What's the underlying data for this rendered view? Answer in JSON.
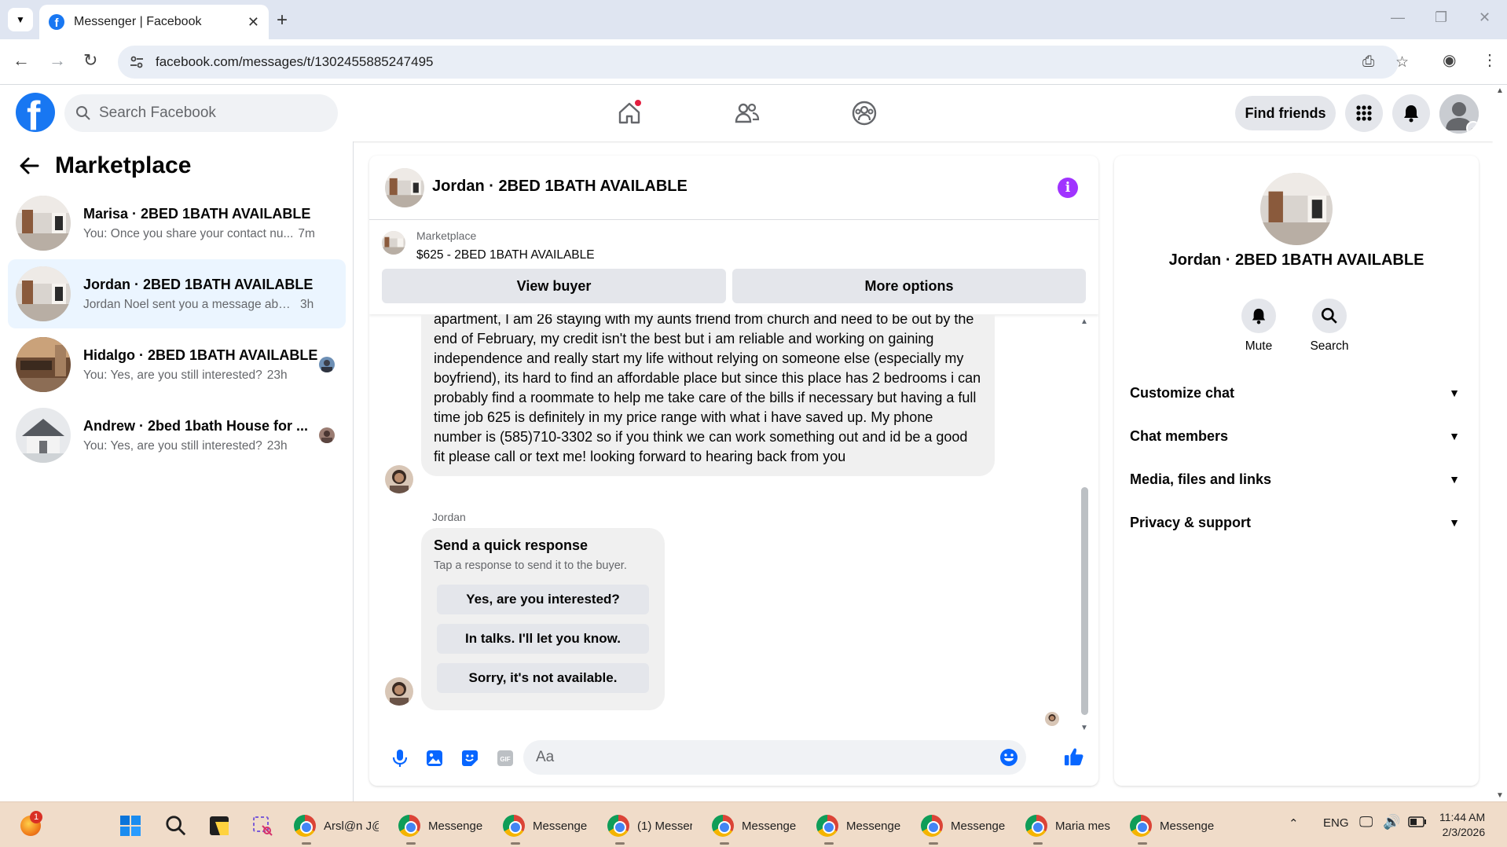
{
  "browser": {
    "tab_title": "Messenger | Facebook",
    "url": "facebook.com/messages/t/1302455885247495"
  },
  "fb": {
    "search_placeholder": "Search Facebook",
    "find_friends": "Find friends"
  },
  "sidebar": {
    "title": "Marketplace",
    "conversations": [
      {
        "name": "Marisa · 2BED 1BATH AVAILABLE",
        "preview": "You: Once you share your contact nu...",
        "time": "7m"
      },
      {
        "name": "Jordan · 2BED 1BATH AVAILABLE",
        "preview": "Jordan Noel sent you a message abou...",
        "time": "3h"
      },
      {
        "name": "Hidalgo · 2BED 1BATH AVAILABLE",
        "preview": "You: Yes, are you still interested?",
        "time": "23h"
      },
      {
        "name": "Andrew · 2bed 1bath House for ...",
        "preview": "You: Yes, are you still interested?",
        "time": "23h"
      }
    ]
  },
  "chat": {
    "header_name": "Jordan · 2BED 1BATH AVAILABLE",
    "marketplace_label": "Marketplace",
    "listing": "$625 - 2BED 1BATH AVAILABLE",
    "view_buyer": "View buyer",
    "more_options": "More options",
    "message_text": "apartment, I am 26 staying with my aunts friend from church and need to be out by the end of February, my credit isn't the best but i am reliable and working on gaining independence and really start my life without relying on someone else (especially my boyfriend), its hard to find an affordable place but since this place has 2 bedrooms i can probably find a roommate to help me take care of the  bills if necessary but having a full time job 625 is definitely in my price range with what i have saved up. My phone number is (585)710-3302 so if you think we can work something out and id be a good fit please call or text me! looking forward to hearing back from you",
    "sender_label": "Jordan",
    "quick_title": "Send a quick response",
    "quick_sub": "Tap a response to send it to the buyer.",
    "quick_options": [
      "Yes, are you interested?",
      "In talks. I'll let you know.",
      "Sorry, it's not available."
    ],
    "composer_placeholder": "Aa"
  },
  "info": {
    "name": "Jordan · 2BED 1BATH AVAILABLE",
    "mute": "Mute",
    "search": "Search",
    "sections": [
      "Customize chat",
      "Chat members",
      "Media, files and links",
      "Privacy & support"
    ]
  },
  "taskbar": {
    "badge": "1",
    "apps": [
      "Arsl@n J@",
      "Messenge",
      "Messenge",
      "(1) Messer",
      "Messenge",
      "Messenge",
      "Messenge",
      "Maria mes",
      "Messenge"
    ],
    "lang": "ENG",
    "time": "11:44 AM",
    "date": "2/3/2026"
  },
  "colors": {
    "fb_blue": "#1877f2",
    "active_row": "#ebf5ff",
    "info_purple": "#a033ff",
    "taskbar": "#f0dcc9"
  }
}
